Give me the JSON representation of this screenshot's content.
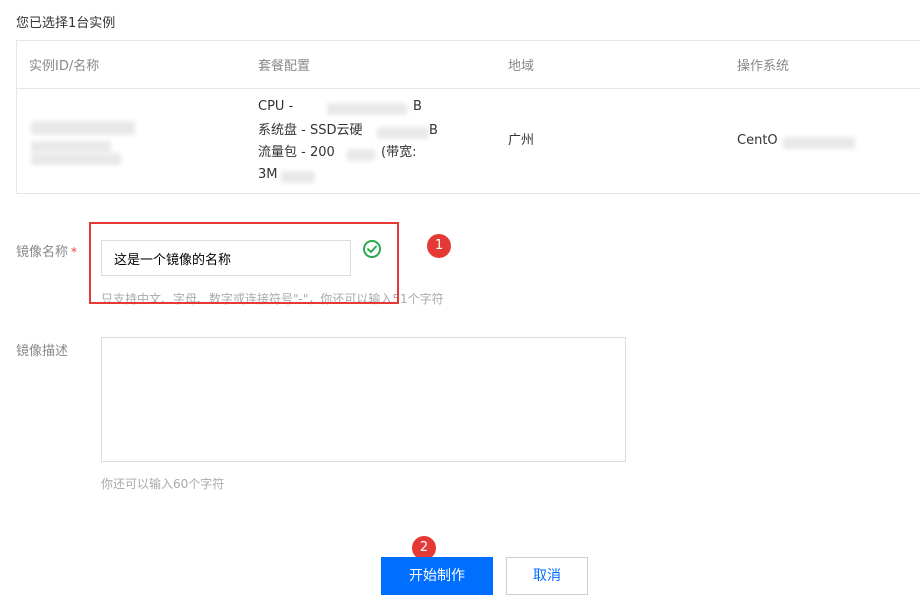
{
  "selection": {
    "note": "您已选择1台实例"
  },
  "table": {
    "headers": [
      "实例ID/名称",
      "套餐配置",
      "地域",
      "操作系统"
    ],
    "row": {
      "package_lines": [
        "CPU - ",
        "系统盘 - SSD云硬",
        "流量包 - 200",
        "3M"
      ],
      "package_suffixes": [
        "B",
        "B",
        "(带宽:",
        ""
      ],
      "region": "广州",
      "os": "CentO"
    }
  },
  "form": {
    "name_label": "镜像名称",
    "required_mark": "*",
    "name_value": "这是一个镜像的名称",
    "name_hint": "只支持中文、字母、数字或连接符号\"-\"，你还可以输入51个字符",
    "desc_label": "镜像描述",
    "desc_value": "",
    "desc_hint": "你还可以输入60个字符"
  },
  "annotations": {
    "badge1": "1",
    "badge2": "2"
  },
  "buttons": {
    "start": "开始制作",
    "cancel": "取消"
  },
  "colors": {
    "primary": "#006eff",
    "success": "#2aa94e",
    "annotation": "#e53935"
  }
}
